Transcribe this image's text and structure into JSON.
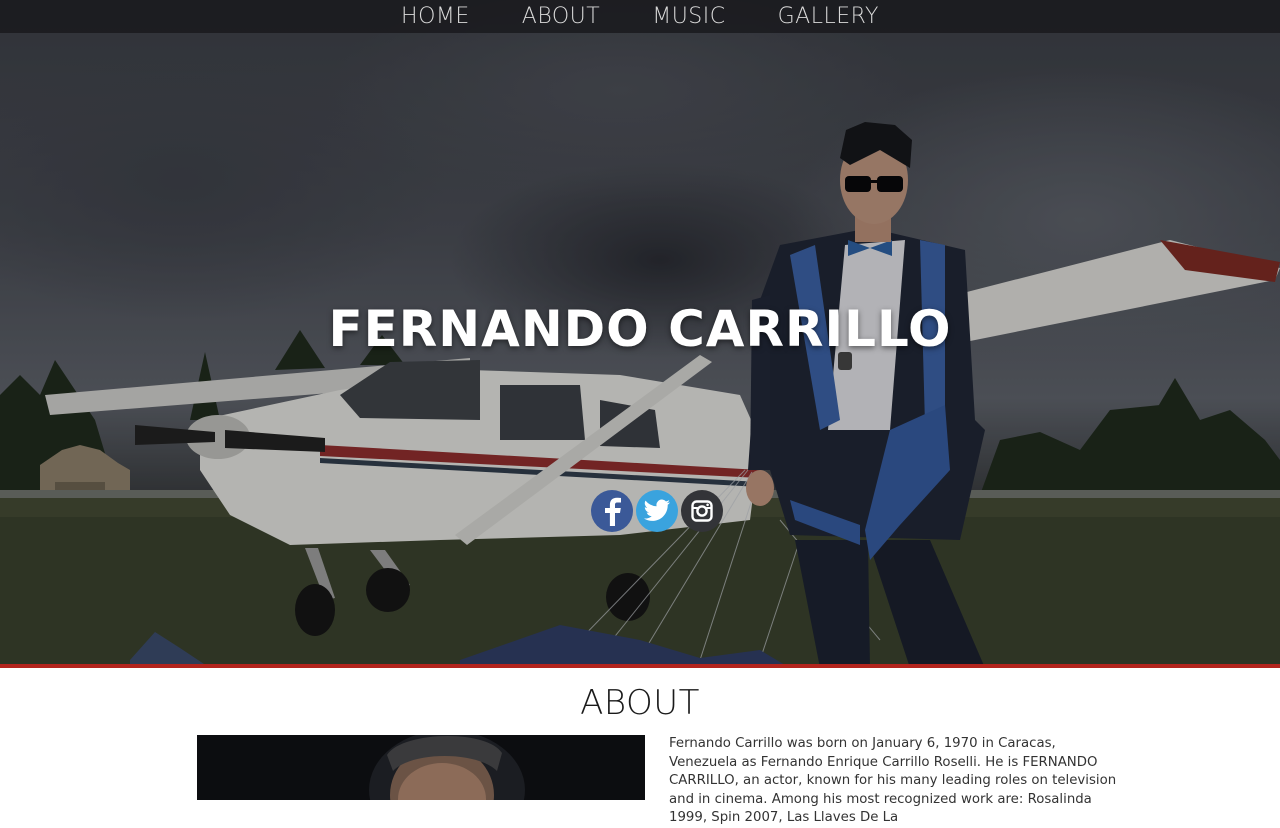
{
  "nav": {
    "items": [
      {
        "label": "HOME"
      },
      {
        "label": "ABOUT"
      },
      {
        "label": "MUSIC"
      },
      {
        "label": "GALLERY"
      }
    ]
  },
  "hero": {
    "title": "FERNANDO CARRILLO",
    "social": [
      {
        "icon": "facebook-icon",
        "color": "#3b5998"
      },
      {
        "icon": "twitter-icon",
        "color": "#3aa3de"
      },
      {
        "icon": "instagram-icon",
        "color": "#333438"
      }
    ],
    "accent_border_color": "#b3241d"
  },
  "about": {
    "title": "ABOUT",
    "bio": "Fernando Carrillo was born on January 6, 1970 in Caracas, Venezuela as Fernando Enrique Carrillo Roselli. He is FERNANDO CARRILLO, an actor, known for his many leading roles on television and in cinema. Among his most recognized work are: Rosalinda 1999, Spin 2007, Las Llaves De La"
  }
}
